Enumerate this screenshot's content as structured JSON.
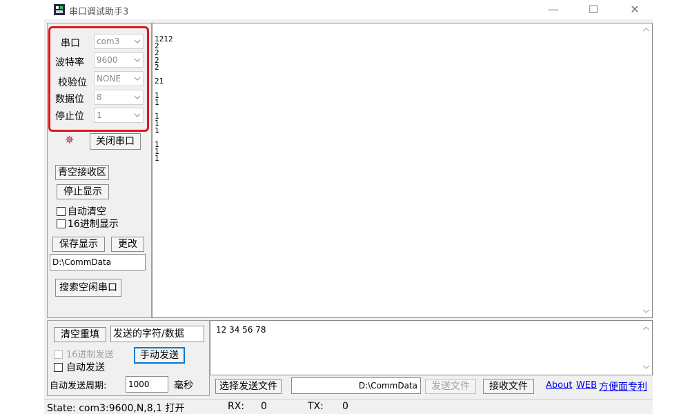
{
  "window": {
    "title": "串口调试助手3",
    "minimize_glyph": "—",
    "maximize_glyph": "☐",
    "close_glyph": "✕"
  },
  "port_settings": {
    "port_label": "串口",
    "port_value": "com3",
    "baud_label": "波特率",
    "baud_value": "9600",
    "parity_label": "校验位",
    "parity_value": "NONE",
    "databits_label": "数据位",
    "databits_value": "8",
    "stopbits_label": "停止位",
    "stopbits_value": "1"
  },
  "port_control": {
    "indicator_glyph": "✵",
    "indicator_color": "#e0141e",
    "close_port_label": "关闭串口"
  },
  "receive_controls": {
    "clear_receive_label": "青空接收区",
    "stop_display_label": "停止显示",
    "auto_clear_label": "自动清空",
    "hex_display_label": "16进制显示",
    "save_display_label": "保存显示",
    "change_label": "更改",
    "save_path": "D:\\CommData",
    "search_ports_label": "搜索空闲串口"
  },
  "receive_area": {
    "text": "1212\n2\n2\n2\n2\n\n21\n\n1\n1\n\n1\n1\n1\n\n1\n1\n1"
  },
  "send_controls": {
    "clear_refill_label": "清空重填",
    "send_type_label": "发送的字符/数据",
    "hex_send_label": "16进制发送",
    "manual_send_label": "手动发送",
    "auto_send_label": "自动发送",
    "auto_period_label": "自动发送周期:",
    "auto_period_value": "1000",
    "ms_label": "毫秒",
    "send_text": "12 34 56 78"
  },
  "file_controls": {
    "select_file_label": "选择发送文件",
    "file_path": "D:\\CommData",
    "send_file_label": "发送文件",
    "receive_file_label": "接收文件"
  },
  "links": {
    "about": "About",
    "web": "WEB",
    "patent": "方便面专利"
  },
  "status_bar": {
    "state": "State: com3:9600,N,8,1 打开",
    "rx_label": "RX:",
    "rx_value": "0",
    "tx_label": "TX:",
    "tx_value": "0"
  },
  "colors": {
    "highlight_box": "#e0141e",
    "link": "#0000ee",
    "disabled_text": "#a0a0a0",
    "focus_border": "#0078d7"
  }
}
